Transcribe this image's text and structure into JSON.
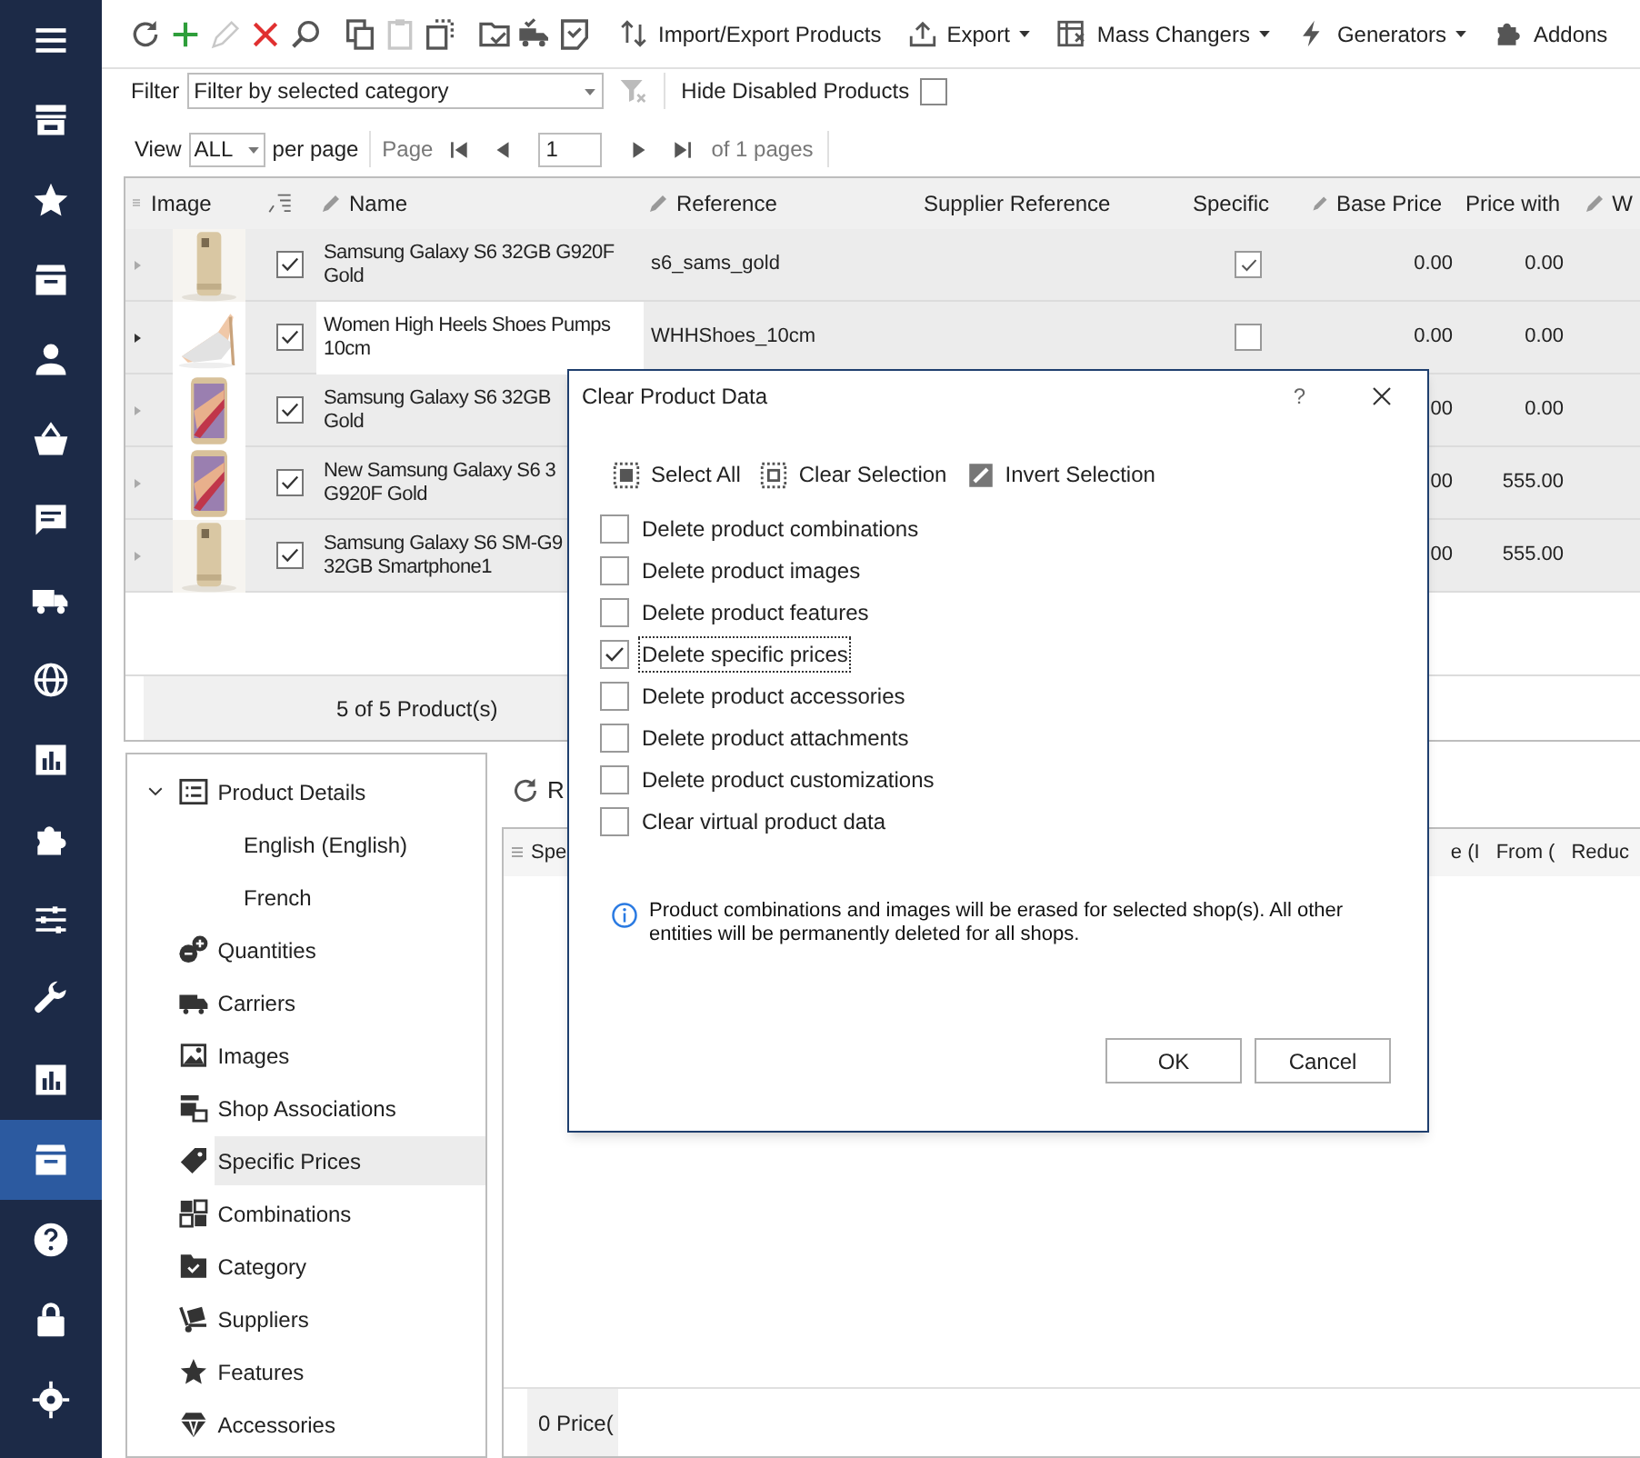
{
  "sidebar": {
    "items": [
      {
        "selected": false
      },
      {
        "selected": false
      },
      {
        "selected": false
      },
      {
        "selected": false
      },
      {
        "selected": false
      },
      {
        "selected": false
      },
      {
        "selected": false
      },
      {
        "selected": false
      },
      {
        "selected": false
      },
      {
        "selected": false
      },
      {
        "selected": false
      },
      {
        "selected": false
      },
      {
        "selected": false
      },
      {
        "selected": false
      },
      {
        "selected": true
      },
      {
        "selected": false
      },
      {
        "selected": false
      },
      {
        "selected": false
      }
    ]
  },
  "toolbar": {
    "icon_buttons": [
      {
        "disabled": false
      },
      {
        "disabled": false
      },
      {
        "disabled": true
      },
      {
        "disabled": false
      },
      {
        "disabled": false
      },
      {
        "disabled": false
      },
      {
        "disabled": true
      },
      {
        "disabled": false
      },
      {
        "disabled": false
      },
      {
        "disabled": false
      },
      {
        "disabled": false
      }
    ],
    "buttons": [
      {
        "label": "Import/Export Products",
        "dropdown": false
      },
      {
        "label": "Export",
        "dropdown": true
      },
      {
        "label": "Mass Changers",
        "dropdown": true
      },
      {
        "label": "Generators",
        "dropdown": true
      },
      {
        "label": "Addons",
        "dropdown": false
      }
    ]
  },
  "filter": {
    "label": "Filter",
    "value": "Filter by selected category",
    "hide_disabled_label": "Hide Disabled Products",
    "hide_disabled": false
  },
  "pager": {
    "view_label": "View",
    "view_value": "ALL",
    "per_page": "per page",
    "page_label": "Page",
    "page_value": "1",
    "of_pages": "of 1 pages"
  },
  "grid": {
    "columns": [
      "Image",
      "Name",
      "Reference",
      "Supplier Reference",
      "Specific",
      "Base Price",
      "Price with",
      "W"
    ],
    "rows": [
      {
        "name": "Samsung Galaxy S6 32GB G920F Gold",
        "reference": "s6_sams_gold",
        "specific": true,
        "base_price": "0.00",
        "price_with": "0.00",
        "checked": true,
        "current": false
      },
      {
        "name": "Women High Heels Shoes Pumps 10cm",
        "reference": "WHHShoes_10cm",
        "specific": false,
        "base_price": "0.00",
        "price_with": "0.00",
        "checked": true,
        "current": true
      },
      {
        "name": "Samsung Galaxy S6 32GB\nGold",
        "base_price": "00",
        "price_with": "0.00",
        "checked": true,
        "current": false
      },
      {
        "name": "New Samsung Galaxy S6 3\nG920F Gold",
        "base_price": "00",
        "price_with": "555.00",
        "checked": true,
        "current": false
      },
      {
        "name": "Samsung Galaxy S6 SM-G9\n32GB Smartphone1",
        "base_price": "00",
        "price_with": "555.00",
        "checked": true,
        "current": false
      }
    ],
    "footer": "5 of 5 Product(s)"
  },
  "tree": [
    {
      "label": "Product Details",
      "expanded": true,
      "selected": false,
      "children": [
        {
          "label": "English (English)",
          "selected": false
        },
        {
          "label": "French",
          "selected": false
        }
      ]
    },
    {
      "label": "Quantities",
      "selected": false
    },
    {
      "label": "Carriers",
      "selected": false
    },
    {
      "label": "Images",
      "selected": false
    },
    {
      "label": "Shop Associations",
      "selected": false
    },
    {
      "label": "Specific Prices",
      "selected": true
    },
    {
      "label": "Combinations",
      "selected": false
    },
    {
      "label": "Category",
      "selected": false
    },
    {
      "label": "Suppliers",
      "selected": false
    },
    {
      "label": "Features",
      "selected": false
    },
    {
      "label": "Accessories",
      "selected": false
    }
  ],
  "detail": {
    "refresh_label": "R",
    "columns": [
      "Spe",
      "e (I",
      "From (",
      "Reduc"
    ],
    "footer": "0 Price("
  },
  "dialog": {
    "title": "Clear Product Data",
    "help": "?",
    "actions": [
      "Select All",
      "Clear Selection",
      "Invert Selection"
    ],
    "options": [
      {
        "label": "Delete product combinations",
        "checked": false,
        "focused": false
      },
      {
        "label": "Delete product images",
        "checked": false,
        "focused": false
      },
      {
        "label": "Delete product features",
        "checked": false,
        "focused": false
      },
      {
        "label": "Delete specific prices",
        "checked": true,
        "focused": true
      },
      {
        "label": "Delete product accessories",
        "checked": false,
        "focused": false
      },
      {
        "label": "Delete product attachments",
        "checked": false,
        "focused": false
      },
      {
        "label": "Delete product customizations",
        "checked": false,
        "focused": false
      },
      {
        "label": "Clear virtual product data",
        "checked": false,
        "focused": false
      }
    ],
    "note": "Product combinations and images will be erased for selected shop(s). All other entities will be permanently deleted for all shops.",
    "buttons": [
      "OK",
      "Cancel"
    ]
  }
}
